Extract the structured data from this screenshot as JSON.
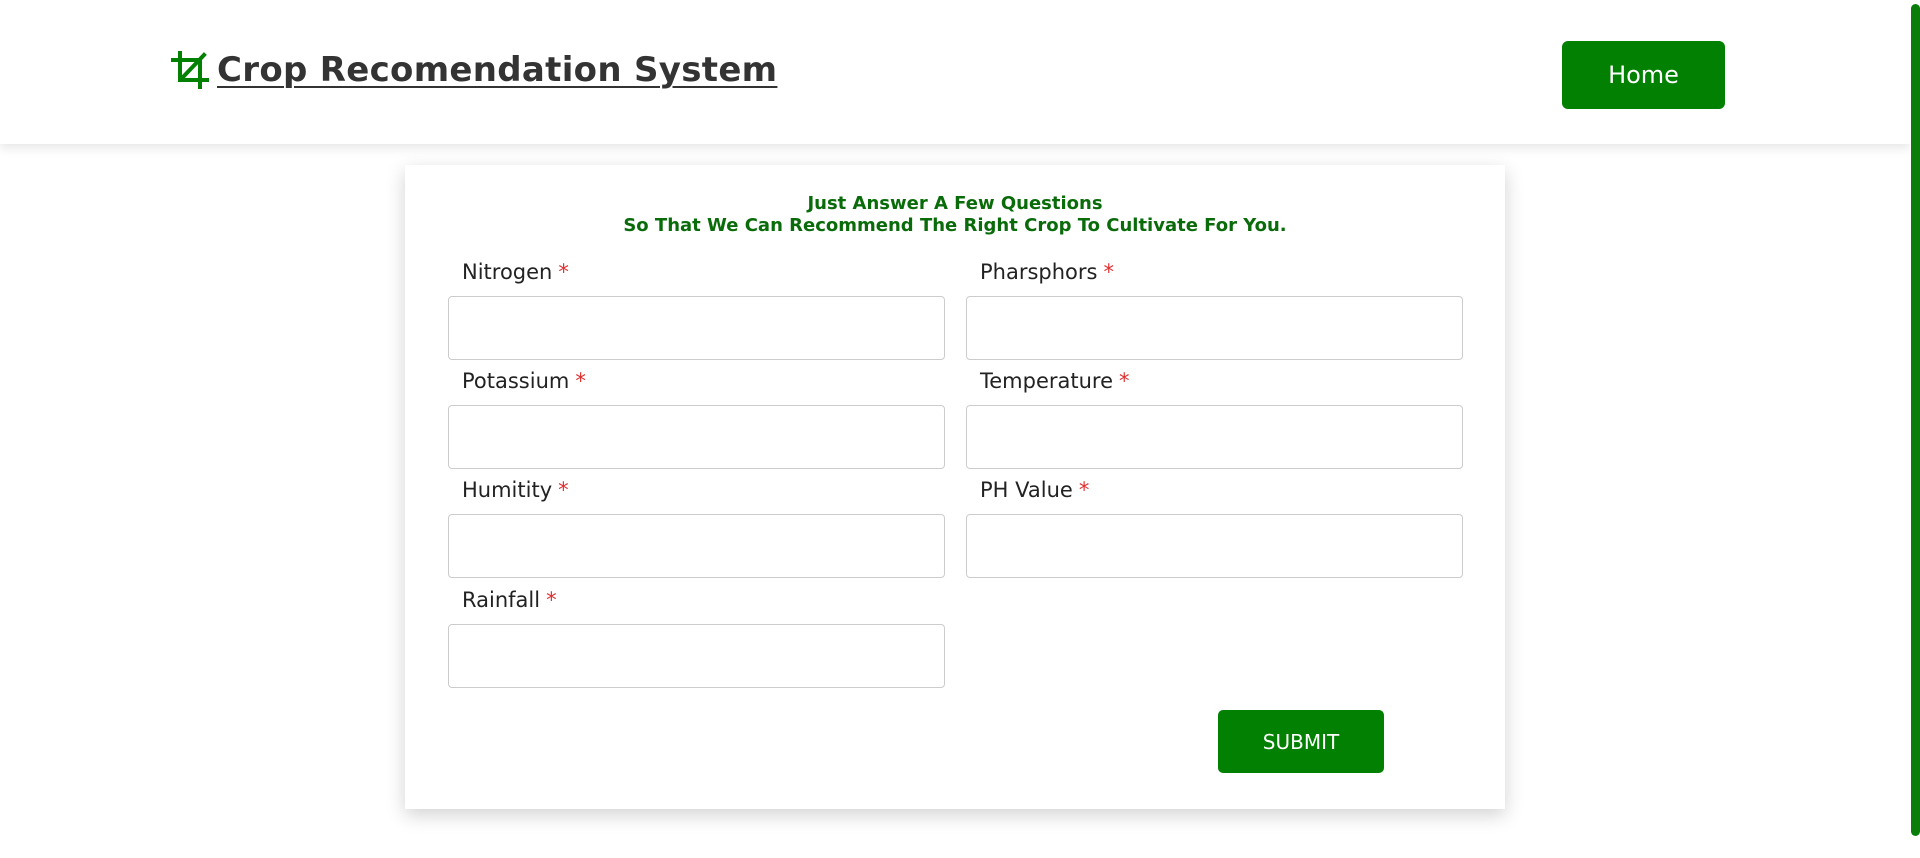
{
  "colors": {
    "brand_green": "#028001",
    "heading_green": "#0a6b0a",
    "required_red": "#e03030"
  },
  "header": {
    "title": " Crop Recomendation System",
    "brand_icon": "crop-icon",
    "home_label": "Home"
  },
  "form": {
    "intro_line1": "Just Answer A Few Questions",
    "intro_line2": "So That We Can Recommend The Right Crop To Cultivate For You.",
    "required_marker": "*",
    "fields": [
      {
        "label": "Nitrogen",
        "value": "",
        "placeholder": ""
      },
      {
        "label": "Pharsphors",
        "value": "",
        "placeholder": ""
      },
      {
        "label": "Potassium",
        "value": "",
        "placeholder": ""
      },
      {
        "label": "Temperature",
        "value": "",
        "placeholder": ""
      },
      {
        "label": "Humitity",
        "value": "",
        "placeholder": ""
      },
      {
        "label": "PH Value",
        "value": "",
        "placeholder": ""
      },
      {
        "label": "Rainfall",
        "value": "",
        "placeholder": ""
      }
    ],
    "submit_label": "SUBMIT"
  }
}
